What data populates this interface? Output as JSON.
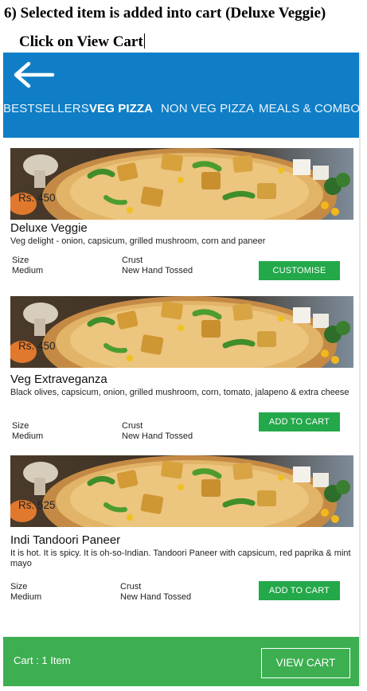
{
  "captions": {
    "step": "6) Selected item is added into cart (Deluxe Veggie)",
    "instruction": "Click on View Cart"
  },
  "header": {
    "back_icon": "arrow-left-icon",
    "tabs": [
      "BESTSELLERS",
      "VEG PIZZA",
      "NON VEG PIZZA",
      "MEALS & COMBOS"
    ],
    "active_tab": "VEG PIZZA"
  },
  "products": [
    {
      "price": "Rs. 450",
      "name": "Deluxe Veggie",
      "description": "Veg delight - onion, capsicum, grilled mushroom, corn and paneer",
      "size_label": "Size",
      "size_value": "Medium",
      "crust_label": "Crust",
      "crust_value": "New Hand Tossed",
      "action_label": "CUSTOMISE"
    },
    {
      "price": "Rs. 450",
      "name": "Veg Extraveganza",
      "description": "Black olives, capsicum, onion, grilled mushroom, corn, tomato, jalapeno & extra cheese",
      "size_label": "Size",
      "size_value": "Medium",
      "crust_label": "Crust",
      "crust_value": "New Hand Tossed",
      "action_label": "ADD TO CART"
    },
    {
      "price": "Rs. 525",
      "name": "Indi Tandoori Paneer",
      "description": "It is hot. It is spicy. It is oh-so-Indian. Tandoori Paneer with capsicum, red paprika & mint mayo",
      "size_label": "Size",
      "size_value": "Medium",
      "crust_label": "Crust",
      "crust_value": "New Hand Tossed",
      "action_label": "ADD TO CART"
    }
  ],
  "cart": {
    "summary": "Cart : 1 Item",
    "view_cart_label": "VIEW CART"
  },
  "colors": {
    "header": "#0f7ec6",
    "button": "#23a84a",
    "cart_bar": "#3daf51"
  }
}
